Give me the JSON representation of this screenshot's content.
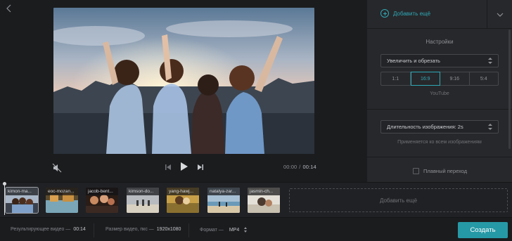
{
  "preview": {
    "time_current": "00:00",
    "time_separator": "/",
    "time_total": "00:14"
  },
  "panel": {
    "add_more_label": "Добавить ещё",
    "settings_title": "Настройки",
    "mode_select_value": "Увеличить и обрезать",
    "aspect_ratios": [
      {
        "label": "1:1",
        "active": false
      },
      {
        "label": "16:9",
        "active": true
      },
      {
        "label": "9:16",
        "active": false
      },
      {
        "label": "5:4",
        "active": false
      }
    ],
    "ratio_caption": "YouTube",
    "duration_select_value": "Длительность изображения: 2s",
    "applies_caption": "Применяется ко всем изображениям",
    "smooth_transition_label": "Плавный переход",
    "smooth_transition_checked": false
  },
  "timeline": {
    "clips": [
      {
        "name": "kimon-ma..."
      },
      {
        "name": "eoc-mozan..."
      },
      {
        "name": "jacob-bent..."
      },
      {
        "name": "kimson-do..."
      },
      {
        "name": "yang-hawj..."
      },
      {
        "name": "natalya-zar..."
      },
      {
        "name": "jasmin-ch..."
      }
    ],
    "add_more_label": "Добавить ещё"
  },
  "bottom": {
    "result_label": "Результирующее видео —",
    "result_value": "00:14",
    "size_label": "Размер видео, пкс —",
    "size_value": "1920x1080",
    "format_label": "Формат —",
    "format_value": "MP4",
    "create_label": "Создать"
  },
  "colors": {
    "accent": "#2fa8b6",
    "create_button": "#2699a6",
    "panel_bg": "#27282b",
    "app_bg": "#1b1c1e"
  },
  "icons": {
    "back": "chevron-left-icon",
    "collapse": "chevron-down-icon",
    "mute": "speaker-muted-icon",
    "prev": "skip-previous-icon",
    "play": "play-icon",
    "next": "skip-next-icon"
  }
}
